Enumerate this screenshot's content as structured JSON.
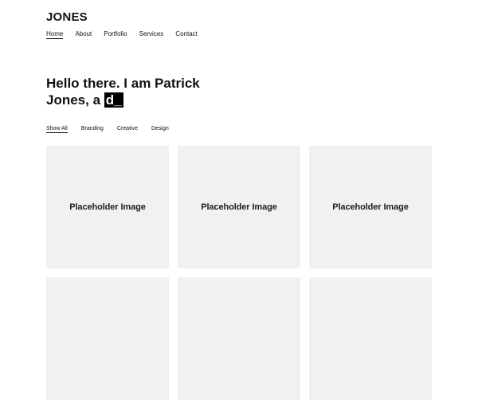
{
  "site": {
    "brand": "JONES"
  },
  "nav": {
    "items": [
      {
        "label": "Home",
        "active": true
      },
      {
        "label": "About"
      },
      {
        "label": "Portfolio"
      },
      {
        "label": "Services"
      },
      {
        "label": "Contact"
      }
    ]
  },
  "hero": {
    "line1": "Hello there. I am Patrick",
    "line2_prefix": "Jones, a ",
    "typed_text": "d_"
  },
  "filters": {
    "items": [
      {
        "label": "Show All",
        "active": true
      },
      {
        "label": "Branding"
      },
      {
        "label": "Creative"
      },
      {
        "label": "Design"
      }
    ]
  },
  "portfolio": {
    "items": [
      {
        "label": "Placeholder Image"
      },
      {
        "label": "Placeholder Image"
      },
      {
        "label": "Placeholder Image"
      },
      {
        "label": ""
      },
      {
        "label": ""
      },
      {
        "label": ""
      }
    ]
  }
}
